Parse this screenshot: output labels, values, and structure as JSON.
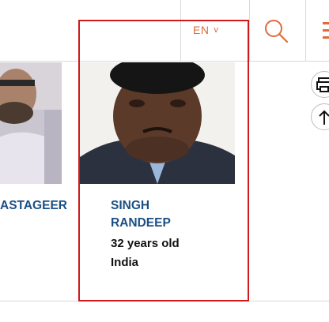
{
  "header": {
    "language": "EN",
    "language_chevron": "v",
    "search_icon": "search-icon",
    "menu_icon": "hamburger-menu-icon",
    "accent_color": "#e06a3b"
  },
  "cards": [
    {
      "name_line1": "ASTAGEER",
      "photo": "person-photo"
    },
    {
      "name_line1": "SINGH",
      "name_line2": "RANDEEP",
      "age": "32 years old",
      "nationality": "India",
      "photo": "person-photo"
    }
  ],
  "side_tools": {
    "print_icon": "print-icon",
    "up_icon": "arrow-up-icon"
  },
  "colors": {
    "name": "#1b4f84",
    "highlight": "#d0191b"
  }
}
